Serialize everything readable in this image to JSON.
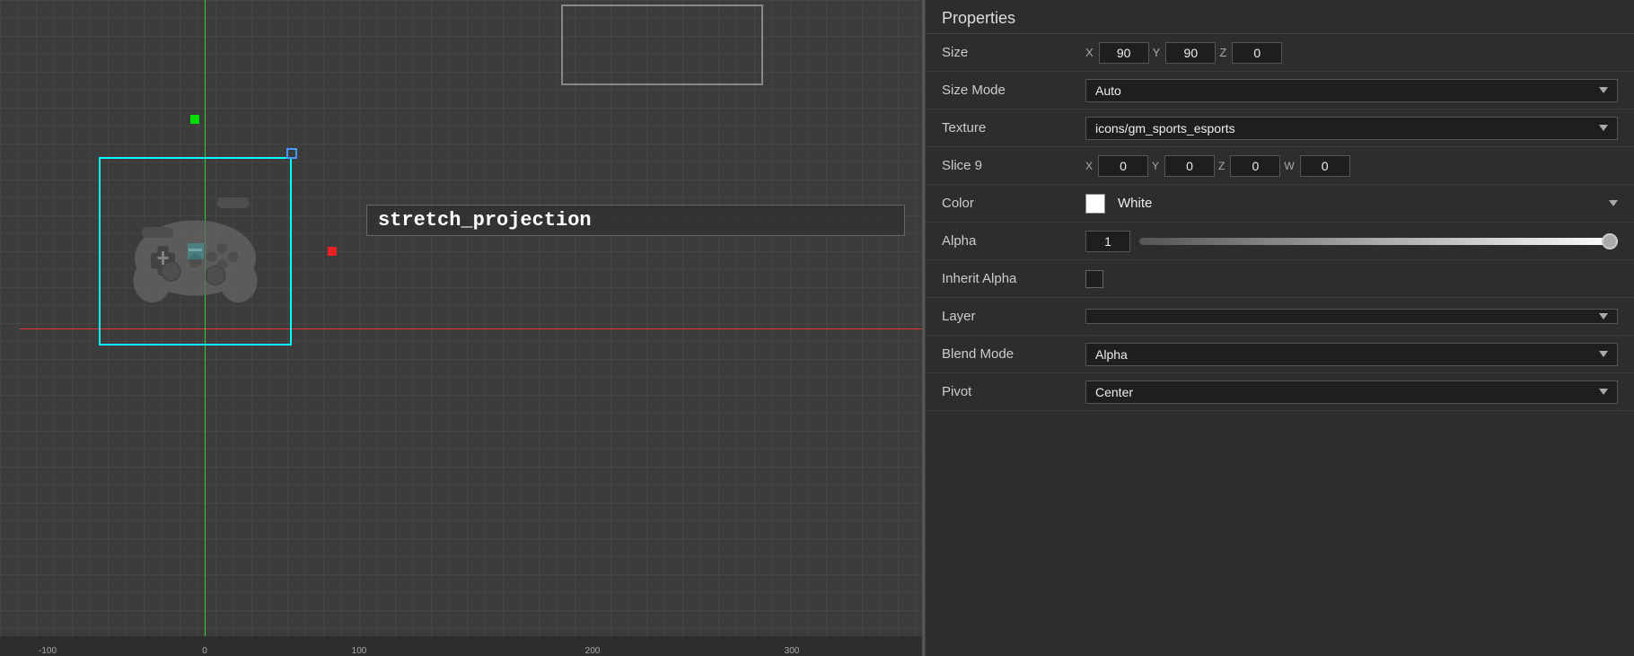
{
  "panel": {
    "title": "Properties",
    "rows": [
      {
        "id": "size",
        "label": "Size",
        "type": "xyz",
        "x": "90",
        "y": "90",
        "z": "0"
      },
      {
        "id": "size_mode",
        "label": "Size Mode",
        "type": "dropdown",
        "value": "Auto"
      },
      {
        "id": "texture",
        "label": "Texture",
        "type": "dropdown",
        "value": "icons/gm_sports_esports"
      },
      {
        "id": "slice9",
        "label": "Slice 9",
        "type": "slice9",
        "x": "0",
        "y": "0",
        "z": "0",
        "w": "0"
      },
      {
        "id": "color",
        "label": "Color",
        "type": "color",
        "swatch": "#ffffff",
        "value": "White"
      },
      {
        "id": "alpha",
        "label": "Alpha",
        "type": "alpha",
        "value": "1"
      },
      {
        "id": "inherit_alpha",
        "label": "Inherit Alpha",
        "type": "checkbox",
        "checked": false
      },
      {
        "id": "layer",
        "label": "Layer",
        "type": "dropdown",
        "value": ""
      },
      {
        "id": "blend_mode",
        "label": "Blend Mode",
        "type": "dropdown",
        "value": "Alpha"
      },
      {
        "id": "pivot",
        "label": "Pivot",
        "type": "dropdown",
        "value": "Center"
      }
    ]
  },
  "canvas": {
    "stretch_label": "stretch_projection",
    "ruler_ticks": [
      "-100",
      "0",
      "100",
      "200",
      "300"
    ]
  },
  "colors": {
    "panel_bg": "#2d2d2d",
    "canvas_bg": "#3c3c3c",
    "accent_cyan": "#00ffff",
    "accent_green": "#00dd00",
    "accent_red": "#ee2222",
    "axis_red": "#cc3333",
    "axis_green": "#33cc33"
  }
}
